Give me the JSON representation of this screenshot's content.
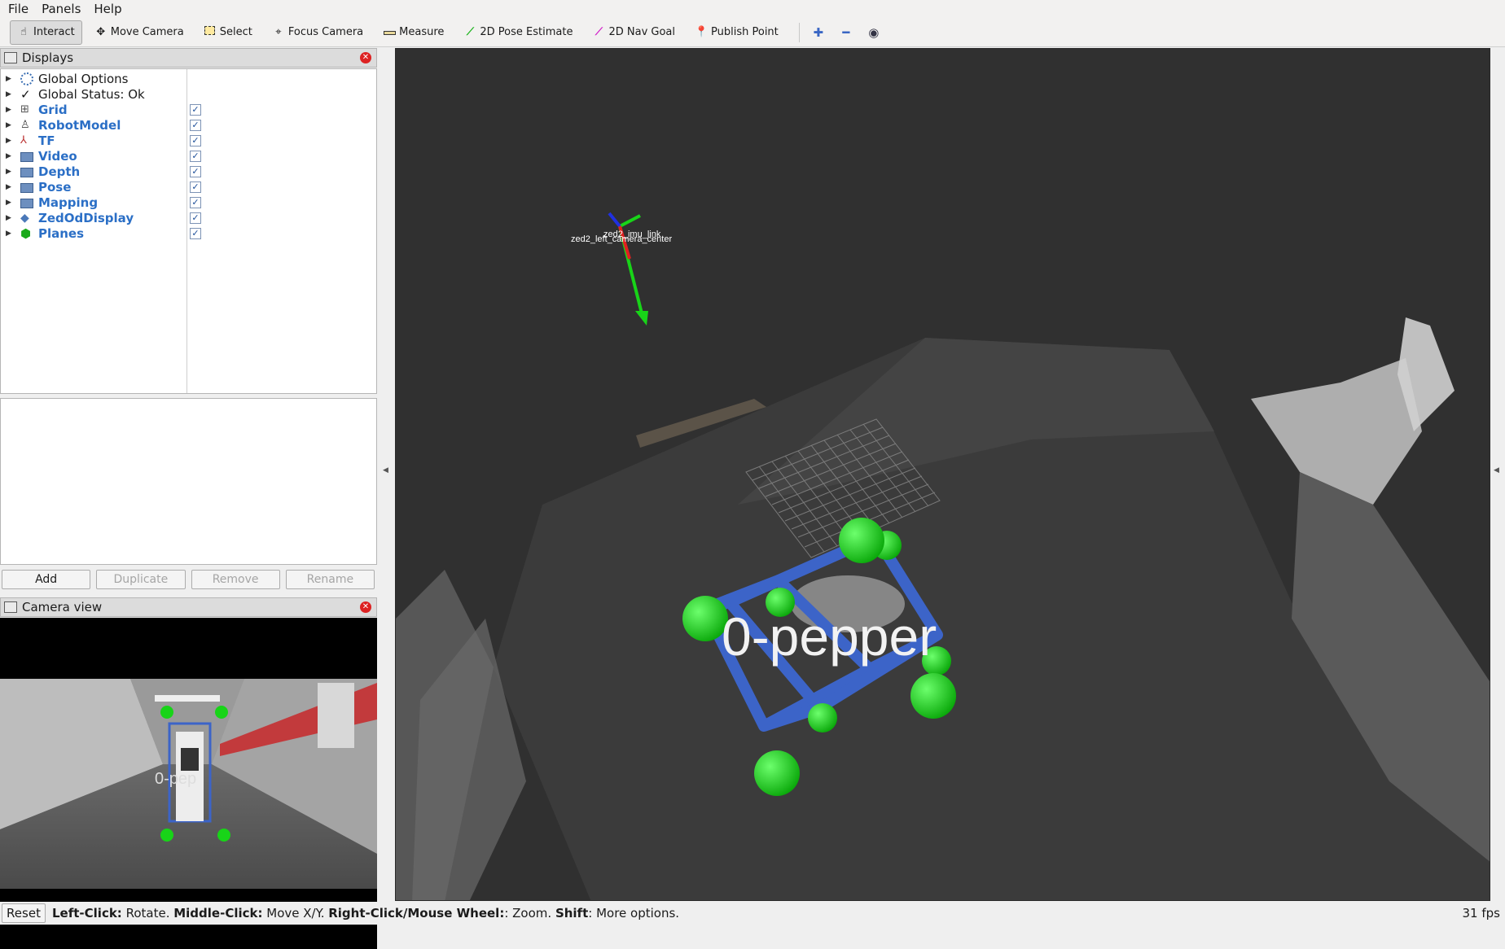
{
  "menu": {
    "file": "File",
    "panels": "Panels",
    "help": "Help"
  },
  "toolbar": {
    "tools": [
      {
        "label": "Interact",
        "icon": "hand-icon"
      },
      {
        "label": "Move Camera",
        "icon": "move-camera-icon"
      },
      {
        "label": "Select",
        "icon": "select-box-icon"
      },
      {
        "label": "Focus Camera",
        "icon": "focus-icon"
      },
      {
        "label": "Measure",
        "icon": "ruler-icon"
      },
      {
        "label": "2D Pose Estimate",
        "icon": "green-arrow-icon"
      },
      {
        "label": "2D Nav Goal",
        "icon": "magenta-arrow-icon"
      },
      {
        "label": "Publish Point",
        "icon": "map-pin-icon"
      }
    ],
    "active": "Interact"
  },
  "displays_panel": {
    "title": "Displays",
    "items": [
      {
        "label": "Global Options",
        "icon": "gear-icon",
        "checkbox": false
      },
      {
        "label": "Global Status: Ok",
        "icon": "check-icon",
        "checkbox": false
      },
      {
        "label": "Grid",
        "icon": "grid-icon",
        "checkbox": true
      },
      {
        "label": "RobotModel",
        "icon": "robot-icon",
        "checkbox": true
      },
      {
        "label": "TF",
        "icon": "axes-icon",
        "checkbox": true
      },
      {
        "label": "Video",
        "icon": "folder-icon",
        "checkbox": true
      },
      {
        "label": "Depth",
        "icon": "folder-icon",
        "checkbox": true
      },
      {
        "label": "Pose",
        "icon": "folder-icon",
        "checkbox": true
      },
      {
        "label": "Mapping",
        "icon": "folder-icon",
        "checkbox": true
      },
      {
        "label": "ZedOdDisplay",
        "icon": "diamond-icon",
        "checkbox": true
      },
      {
        "label": "Planes",
        "icon": "green-cube-icon",
        "checkbox": true
      }
    ],
    "buttons": {
      "add": "Add",
      "duplicate": "Duplicate",
      "remove": "Remove",
      "rename": "Rename"
    }
  },
  "camera_panel": {
    "title": "Camera view",
    "overlay_label": "0-pep"
  },
  "viewport": {
    "object_label": "0-pepper",
    "tf_label_a": "zed2_imu_link",
    "tf_label_b": "zed2_left_camera_center"
  },
  "statusbar": {
    "reset": "Reset",
    "hint_left_key": "Left-Click:",
    "hint_left": " Rotate. ",
    "hint_middle_key": "Middle-Click:",
    "hint_middle": " Move X/Y. ",
    "hint_right_key": "Right-Click/Mouse Wheel:",
    "hint_right": ": Zoom. ",
    "hint_shift_key": "Shift",
    "hint_shift": ": More options.",
    "fps": "31 fps"
  },
  "colors": {
    "accent_blue": "#2b6fc6",
    "viewport_bg": "#303030",
    "sphere_green": "#18d418",
    "box_blue": "#3c64c8"
  }
}
